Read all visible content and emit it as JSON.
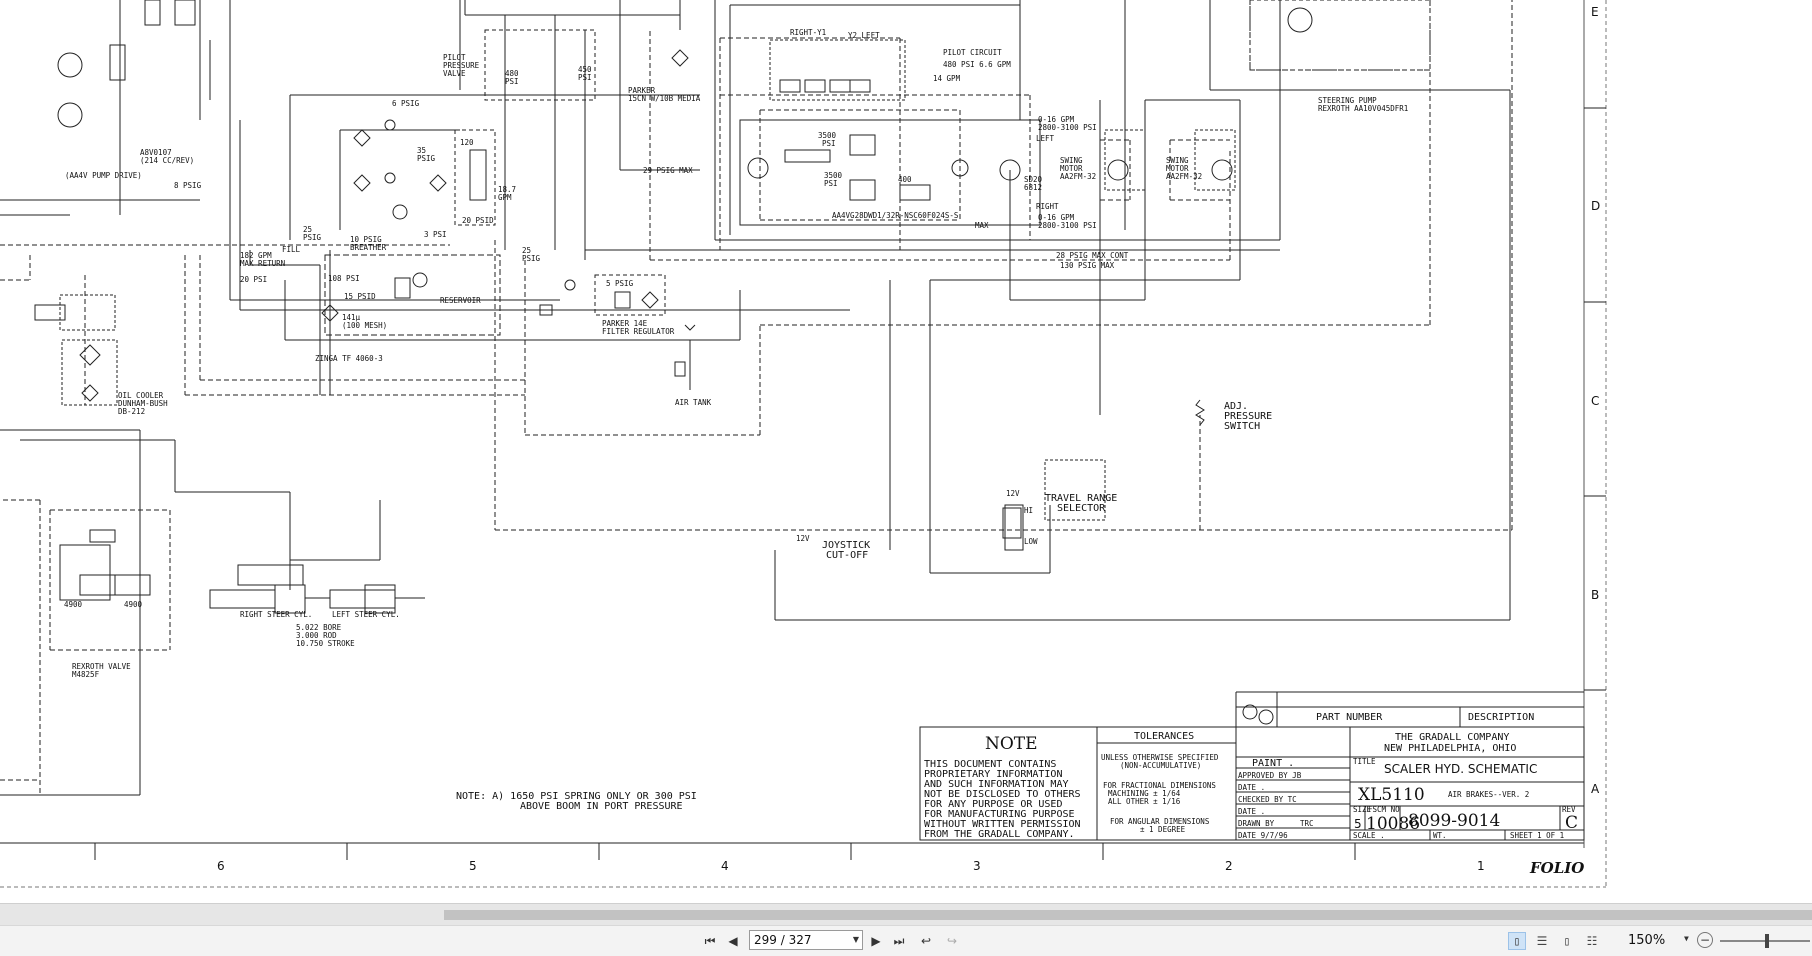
{
  "drawing": {
    "zone_letters": [
      "E",
      "D",
      "C",
      "B",
      "A"
    ],
    "zone_numbers": [
      "6",
      "5",
      "4",
      "3",
      "2",
      "1"
    ],
    "folio": "FOLIO",
    "labels": {
      "pilot_circuit": "PILOT CIRCUIT",
      "pilot_circuit_spec": "480 PSI 6.6 GPM",
      "gpm14": "14 GPM",
      "right_y1": "RIGHT-Y1",
      "y2_left": "Y2 LEFT",
      "pilot_pressure_valve": [
        "PILOT",
        "PRESSURE",
        "VALVE"
      ],
      "psi480": "480",
      "psi450": "450",
      "psi_a": "PSI",
      "psi_b": "PSI",
      "parker_media": [
        "PARKER",
        "15CN W/10B MEDIA"
      ],
      "psi6": "6 PSIG",
      "psi35": [
        "35",
        "PSIG"
      ],
      "psi120": "120",
      "gpm187": [
        "18.7",
        "GPM"
      ],
      "psi20": "20 PSID",
      "psi3": "3 PSI",
      "breather": [
        "10 PSIG",
        "BREATHER"
      ],
      "psi25a": [
        "25",
        "PSIG"
      ],
      "psi25b": [
        "25",
        "PSIG"
      ],
      "return_line": [
        "182 GPM",
        "MAX RETURN",
        "20 PSI"
      ],
      "fill": "FILL",
      "psi108": "108 PSI",
      "psid15": "15 PSID",
      "mesh": [
        "141μ",
        "(100 MESH)"
      ],
      "reservoir": "RESERVOIR",
      "zinga": "ZINGA TF 4060-3",
      "psi5": "5 PSIG",
      "parker_14e": [
        "PARKER 14E",
        "FILTER REGULATOR"
      ],
      "air_tank": "AIR TANK",
      "psig29": "29 PSIG MAX",
      "psi3500a": [
        "3500",
        "PSI"
      ],
      "psi3500b": [
        "3500",
        "PSI"
      ],
      "psi400": "400",
      "pump_model": "AA4VG28DWD1/32R-NSC60F024S-S",
      "max": "MAX",
      "left": "LEFT",
      "right": "RIGHT",
      "gpm_left": [
        "0-16 GPM",
        "2800-3100 PSI"
      ],
      "gpm_right": [
        "0-16 GPM",
        "2800-3100 PSI"
      ],
      "sd20": [
        "SD20",
        "6812"
      ],
      "swing_motor1": [
        "SWING",
        "MOTOR",
        "AA2FM-32"
      ],
      "swing_motor2": [
        "SWING",
        "MOTOR",
        "AA2FM-32"
      ],
      "psig28": "28 PSIG MAX CONT",
      "psig130": "130 PSIG MAX",
      "steering_pump": [
        "STEERING PUMP",
        "REXROTH AA10V045DFR1"
      ],
      "a8v": [
        "A8V0107",
        "(214 CC/REV)"
      ],
      "aa4v": "(AA4V PUMP DRIVE)",
      "psig8": "8 PSIG",
      "oil_cooler": [
        "OIL COOLER",
        "DUNHAM-BUSH",
        "DB-212"
      ],
      "adj_switch": [
        "ADJ.",
        "PRESSURE",
        "SWITCH"
      ],
      "travel_range": [
        "TRAVEL RANGE",
        "SELECTOR"
      ],
      "joystick": [
        "JOYSTICK",
        "CUT-OFF"
      ],
      "v12a": "12V",
      "v12b": "12V",
      "low": "LOW",
      "hi": "HI",
      "right_steer": "RIGHT STEER CYL.",
      "left_steer": "LEFT STEER CYL.",
      "cyl_spec": [
        "5.022 BORE",
        "3.000 ROD",
        "10.750 STROKE"
      ],
      "rexroth_valve": [
        "REXROTH VALVE",
        "M4825F"
      ],
      "psi4900a": "4900",
      "psi4900b": "4900",
      "note_a": [
        "NOTE:  A) 1650 PSI SPRING ONLY OR 300 PSI",
        "ABOVE BOOM IN PORT PRESSURE"
      ]
    },
    "title_block": {
      "note_heading": "NOTE",
      "note_body": [
        "THIS DOCUMENT CONTAINS",
        "PROPRIETARY INFORMATION",
        "AND SUCH INFORMATION MAY",
        "NOT BE DISCLOSED TO OTHERS",
        "FOR ANY PURPOSE OR USED",
        "FOR MANUFACTURING PURPOSE",
        "WITHOUT WRITTEN PERMISSION",
        "FROM THE GRADALL COMPANY."
      ],
      "tolerances_heading": "TOLERANCES",
      "tolerances_unless": [
        "UNLESS OTHERWISE SPECIFIED",
        "(NON-ACCUMULATIVE)"
      ],
      "tolerances_frac": [
        "FOR FRACTIONAL DIMENSIONS",
        "MACHINING        ± 1/64",
        "ALL OTHER        ± 1/16"
      ],
      "tolerances_ang": [
        "FOR ANGULAR DIMENSIONS",
        "± 1 DEGREE"
      ],
      "part_number": "PART NUMBER",
      "description": "DESCRIPTION",
      "company": [
        "THE GRADALL COMPANY",
        "NEW PHILADELPHIA, OHIO"
      ],
      "paint": "PAINT .",
      "approved": "APPROVED BY JB",
      "date1": "DATE .",
      "checked": "CHECKED BY TC",
      "date2": "DATE .",
      "drawn": "DRAWN BY",
      "drawn_initials": "TRC",
      "date3": "DATE 9/7/96",
      "title_label": "TITLE",
      "title": "SCALER HYD. SCHEMATIC",
      "model": "XL5110",
      "subtitle": "AIR BRAKES--VER. 2",
      "size_label": "SIZE",
      "size": "5",
      "fscm_label": "FSCM NO",
      "fscm": "10086",
      "dwg": "8099-9014",
      "rev_label": "REV",
      "rev": "C",
      "scale": "SCALE .",
      "wt": "WT.",
      "sheet": "SHEET 1 OF 1"
    }
  },
  "viewer": {
    "page_input": "299 / 327",
    "zoom": "150%"
  }
}
